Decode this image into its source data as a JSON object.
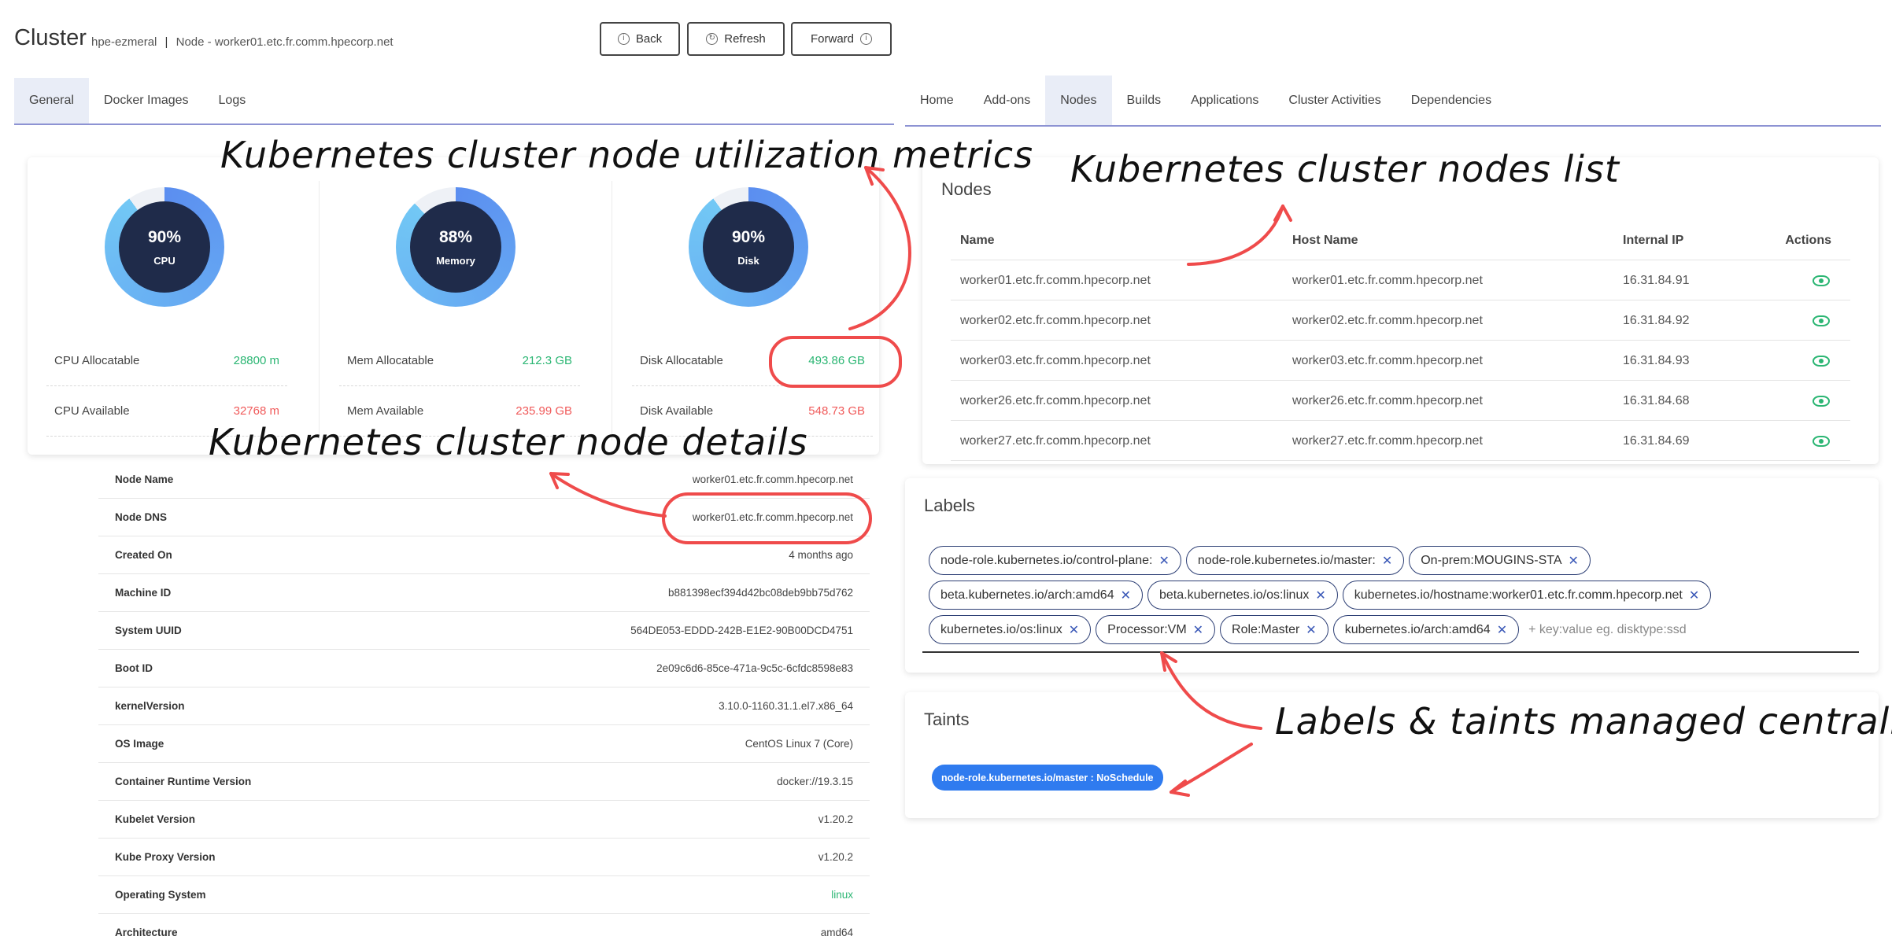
{
  "header": {
    "title": "Cluster",
    "crumb_cluster": "hpe-ezmeral",
    "crumb_separator": "|",
    "crumb_node": "Node - worker01.etc.fr.comm.hpecorp.net",
    "buttons": {
      "back": "Back",
      "refresh": "Refresh",
      "forward": "Forward"
    }
  },
  "left_tabs": [
    "General",
    "Docker Images",
    "Logs"
  ],
  "right_tabs": [
    "Home",
    "Add-ons",
    "Nodes",
    "Builds",
    "Applications",
    "Cluster Activities",
    "Dependencies"
  ],
  "metrics": [
    {
      "pct": "90%",
      "label": "CPU",
      "value": 90,
      "alloc_label": "CPU Allocatable",
      "alloc_value": "28800 m",
      "avail_label": "CPU Available",
      "avail_value": "32768 m"
    },
    {
      "pct": "88%",
      "label": "Memory",
      "value": 88,
      "alloc_label": "Mem Allocatable",
      "alloc_value": "212.3 GB",
      "avail_label": "Mem Available",
      "avail_value": "235.99 GB"
    },
    {
      "pct": "90%",
      "label": "Disk",
      "value": 90,
      "alloc_label": "Disk Allocatable",
      "alloc_value": "493.86 GB",
      "avail_label": "Disk Available",
      "avail_value": "548.73 GB"
    }
  ],
  "details": [
    {
      "key": "Node Name",
      "value": "worker01.etc.fr.comm.hpecorp.net"
    },
    {
      "key": "Node DNS",
      "value": "worker01.etc.fr.comm.hpecorp.net"
    },
    {
      "key": "Created On",
      "value": "4 months ago"
    },
    {
      "key": "Machine ID",
      "value": "b881398ecf394d42bc08deb9bb75d762"
    },
    {
      "key": "System UUID",
      "value": "564DE053-EDDD-242B-E1E2-90B00DCD4751"
    },
    {
      "key": "Boot ID",
      "value": "2e09c6d6-85ce-471a-9c5c-6cfdc8598e83"
    },
    {
      "key": "kernelVersion",
      "value": "3.10.0-1160.31.1.el7.x86_64"
    },
    {
      "key": "OS Image",
      "value": "CentOS Linux 7 (Core)"
    },
    {
      "key": "Container Runtime Version",
      "value": "docker://19.3.15"
    },
    {
      "key": "Kubelet Version",
      "value": "v1.20.2"
    },
    {
      "key": "Kube Proxy Version",
      "value": "v1.20.2"
    },
    {
      "key": "Operating System",
      "value": "linux"
    },
    {
      "key": "Architecture",
      "value": "amd64"
    }
  ],
  "nodes": {
    "title": "Nodes",
    "columns": [
      "Name",
      "Host Name",
      "Internal IP",
      "Actions"
    ],
    "rows": [
      {
        "name": "worker01.etc.fr.comm.hpecorp.net",
        "host": "worker01.etc.fr.comm.hpecorp.net",
        "ip": "16.31.84.91",
        "action_icon": "eye-icon"
      },
      {
        "name": "worker02.etc.fr.comm.hpecorp.net",
        "host": "worker02.etc.fr.comm.hpecorp.net",
        "ip": "16.31.84.92",
        "action_icon": "eye-icon"
      },
      {
        "name": "worker03.etc.fr.comm.hpecorp.net",
        "host": "worker03.etc.fr.comm.hpecorp.net",
        "ip": "16.31.84.93",
        "action_icon": "eye-icon"
      },
      {
        "name": "worker26.etc.fr.comm.hpecorp.net",
        "host": "worker26.etc.fr.comm.hpecorp.net",
        "ip": "16.31.84.68",
        "action_icon": "eye-icon"
      },
      {
        "name": "worker27.etc.fr.comm.hpecorp.net",
        "host": "worker27.etc.fr.comm.hpecorp.net",
        "ip": "16.31.84.69",
        "action_icon": "eye-icon"
      }
    ]
  },
  "labels": {
    "title": "Labels",
    "rows": [
      [
        "node-role.kubernetes.io/control-plane:",
        "node-role.kubernetes.io/master:",
        "On-prem:MOUGINS-STA"
      ],
      [
        "beta.kubernetes.io/arch:amd64",
        "beta.kubernetes.io/os:linux",
        "kubernetes.io/hostname:worker01.etc.fr.comm.hpecorp.net"
      ],
      [
        "kubernetes.io/os:linux",
        "Processor:VM",
        "Role:Master",
        "kubernetes.io/arch:amd64"
      ]
    ],
    "remove_glyph": "✕",
    "input_placeholder": "+ key:value eg. disktype:ssd"
  },
  "taints": {
    "title": "Taints",
    "items": [
      "node-role.kubernetes.io/master : NoSchedule"
    ]
  },
  "annotations": {
    "metrics": "Kubernetes cluster node utilization metrics",
    "nodes": "Kubernetes cluster nodes list",
    "details": "Kubernetes cluster node details",
    "labels": "Labels & taints managed centrally"
  },
  "colors": {
    "gauge_start": "#5b8ef0",
    "gauge_end": "#72c8f5",
    "gauge_core": "#1f2b4a",
    "green": "#2bb673",
    "red": "#f05a5a",
    "highlight": "#ef4b4b",
    "taint": "#2f7bef"
  }
}
